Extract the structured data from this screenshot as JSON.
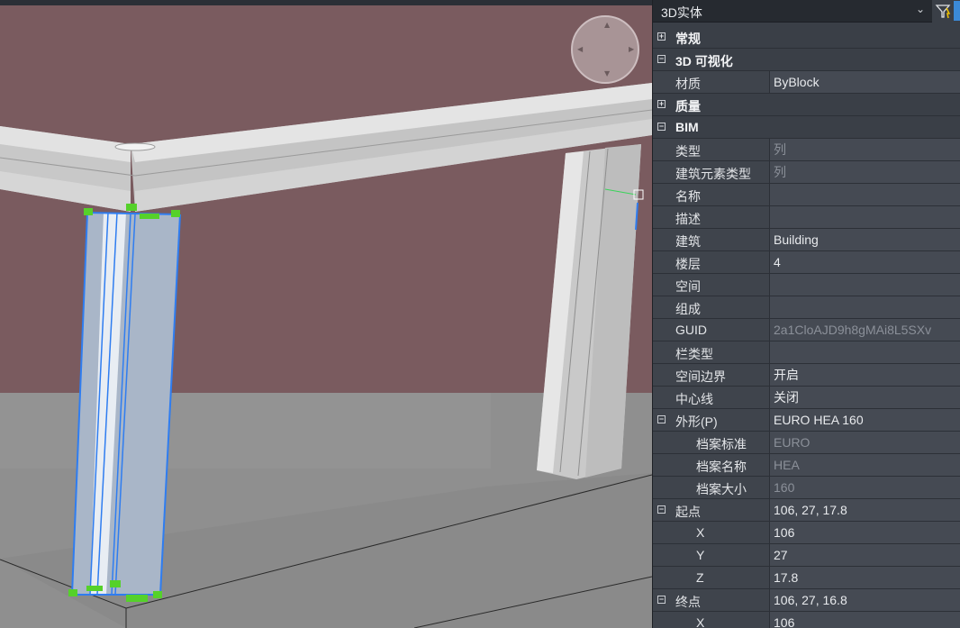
{
  "viewport": {
    "colors": {
      "background": "#7a5b5f",
      "floor": "#8f8f8f",
      "selection": "#2f7df0",
      "grip": "#55d12a"
    }
  },
  "panel": {
    "dropdown_label": "3D实体",
    "rows": [
      {
        "type": "section",
        "expand": "+",
        "name": "常规"
      },
      {
        "type": "section",
        "expand": "−",
        "name": "3D 可视化"
      },
      {
        "type": "prop",
        "name": "材质",
        "value": "ByBlock",
        "grey": false
      },
      {
        "type": "section",
        "expand": "+",
        "name": "质量"
      },
      {
        "type": "section",
        "expand": "−",
        "name": "BIM"
      },
      {
        "type": "prop",
        "name": "类型",
        "value": "列",
        "grey": true
      },
      {
        "type": "prop",
        "name": "建筑元素类型",
        "value": "列",
        "grey": true
      },
      {
        "type": "prop",
        "name": "名称",
        "value": "",
        "grey": false
      },
      {
        "type": "prop",
        "name": "描述",
        "value": "",
        "grey": false
      },
      {
        "type": "prop",
        "name": "建筑",
        "value": "Building",
        "grey": false
      },
      {
        "type": "prop",
        "name": "楼层",
        "value": "4",
        "grey": false
      },
      {
        "type": "prop",
        "name": "空间",
        "value": "",
        "grey": false
      },
      {
        "type": "prop",
        "name": "组成",
        "value": "",
        "grey": false
      },
      {
        "type": "prop",
        "name": "GUID",
        "value": "2a1CloAJD9h8gMAi8L5SXv",
        "grey": true
      },
      {
        "type": "prop",
        "name": "栏类型",
        "value": "",
        "grey": false
      },
      {
        "type": "prop",
        "name": "空间边界",
        "value": "开启",
        "grey": false
      },
      {
        "type": "prop",
        "name": "中心线",
        "value": "关闭",
        "grey": false
      },
      {
        "type": "propsection",
        "expand": "−",
        "name": "外形(P)",
        "value": "EURO HEA 160"
      },
      {
        "type": "sub",
        "name": "档案标准",
        "value": "EURO",
        "grey": true
      },
      {
        "type": "sub",
        "name": "档案名称",
        "value": "HEA",
        "grey": true
      },
      {
        "type": "sub",
        "name": "档案大小",
        "value": "160",
        "grey": true
      },
      {
        "type": "propsection",
        "expand": "−",
        "name": "起点",
        "value": "106, 27, 17.8"
      },
      {
        "type": "sub",
        "name": "X",
        "value": "106",
        "grey": false
      },
      {
        "type": "sub",
        "name": "Y",
        "value": "27",
        "grey": false
      },
      {
        "type": "sub",
        "name": "Z",
        "value": "17.8",
        "grey": false
      },
      {
        "type": "propsection",
        "expand": "−",
        "name": "终点",
        "value": "106, 27, 16.8"
      },
      {
        "type": "sub",
        "name": "X",
        "value": "106",
        "grey": false
      }
    ]
  }
}
